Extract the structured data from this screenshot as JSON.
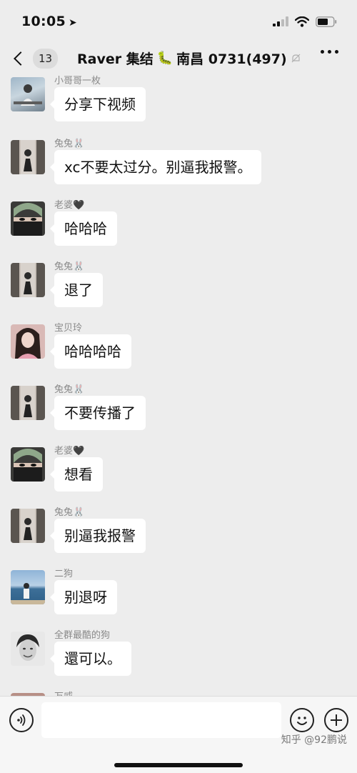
{
  "status_bar": {
    "time": "10:05"
  },
  "nav": {
    "back_count": "13",
    "title_prefix": "Raver 集结",
    "title_emoji": "🐛",
    "title_suffix": "南昌 0731(497)"
  },
  "messages": [
    {
      "sender": "小哥哥一枚",
      "text": "分享下视频",
      "avatar": "man-bench"
    },
    {
      "sender": "兔兔🐰",
      "text": "xc不要太过分。别逼我报警。",
      "avatar": "girl-mirror"
    },
    {
      "sender": "老婆🖤",
      "text": "哈哈哈",
      "avatar": "green-hair"
    },
    {
      "sender": "兔兔🐰",
      "text": "退了",
      "avatar": "girl-mirror"
    },
    {
      "sender": "宝贝玲",
      "text": "哈哈哈哈",
      "avatar": "girl-pink"
    },
    {
      "sender": "兔兔🐰",
      "text": "不要传播了",
      "avatar": "girl-mirror"
    },
    {
      "sender": "老婆🖤",
      "text": "想看",
      "avatar": "green-hair"
    },
    {
      "sender": "兔兔🐰",
      "text": "别逼我报警",
      "avatar": "girl-mirror"
    },
    {
      "sender": "二狗",
      "text": "别退呀",
      "avatar": "seaside"
    },
    {
      "sender": "全群最酷的狗",
      "text": "還可以。",
      "avatar": "bw-portrait"
    },
    {
      "sender": "万威",
      "text": "",
      "avatar": "partial"
    }
  ],
  "watermark": "知乎 @92鹏说"
}
